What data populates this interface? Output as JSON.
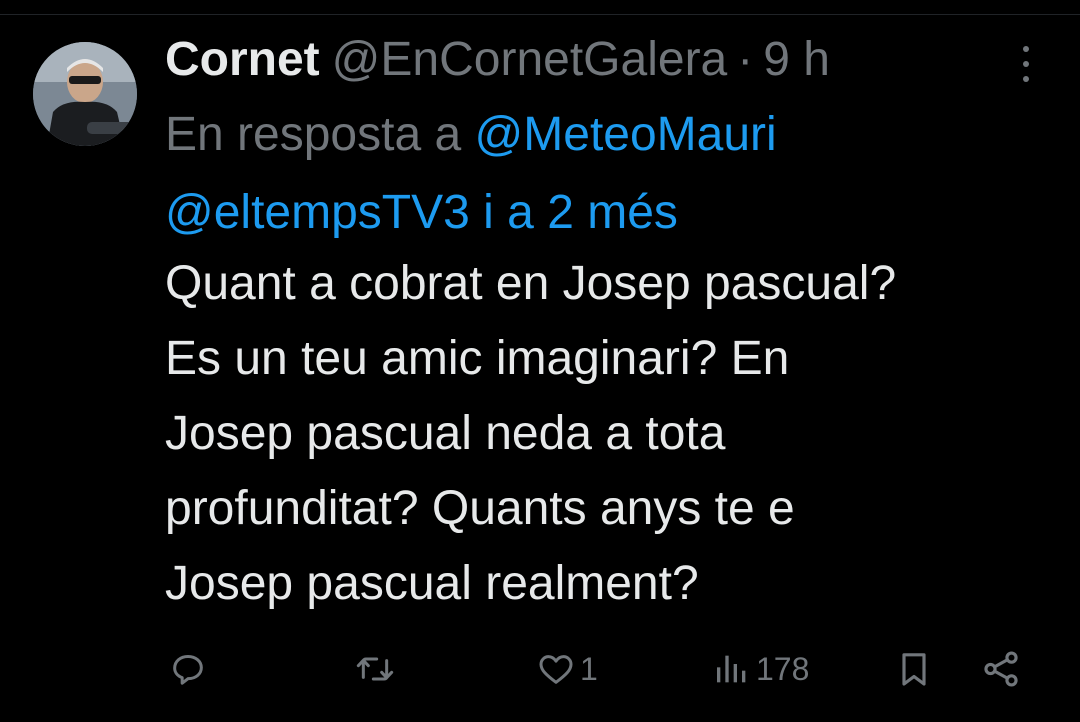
{
  "tweet": {
    "author": {
      "display_name": "Cornet",
      "handle": "@EnCornetGalera"
    },
    "separator": "·",
    "time": "9 h",
    "reply_to": {
      "prefix": "En resposta a",
      "mention_1": "@MeteoMauri",
      "mention_2": "@eltempsTV3",
      "suffix": "i a 2 més"
    },
    "text_lines": [
      "Quant a cobrat en Josep pascual?",
      "Es un teu amic imaginari? En",
      "Josep pascual neda a tota",
      "profunditat? Quants anys te e",
      "Josep pascual realment?"
    ],
    "actions": {
      "reply_icon": "reply-icon",
      "retweet_icon": "retweet-icon",
      "like_icon": "heart-icon",
      "like_count": "1",
      "views_icon": "views-icon",
      "views_count": "178",
      "bookmark_icon": "bookmark-icon",
      "share_icon": "share-icon"
    },
    "colors": {
      "background": "#000000",
      "text": "#e7e9ea",
      "muted": "#71767b",
      "accent": "#1d9bf0"
    }
  }
}
